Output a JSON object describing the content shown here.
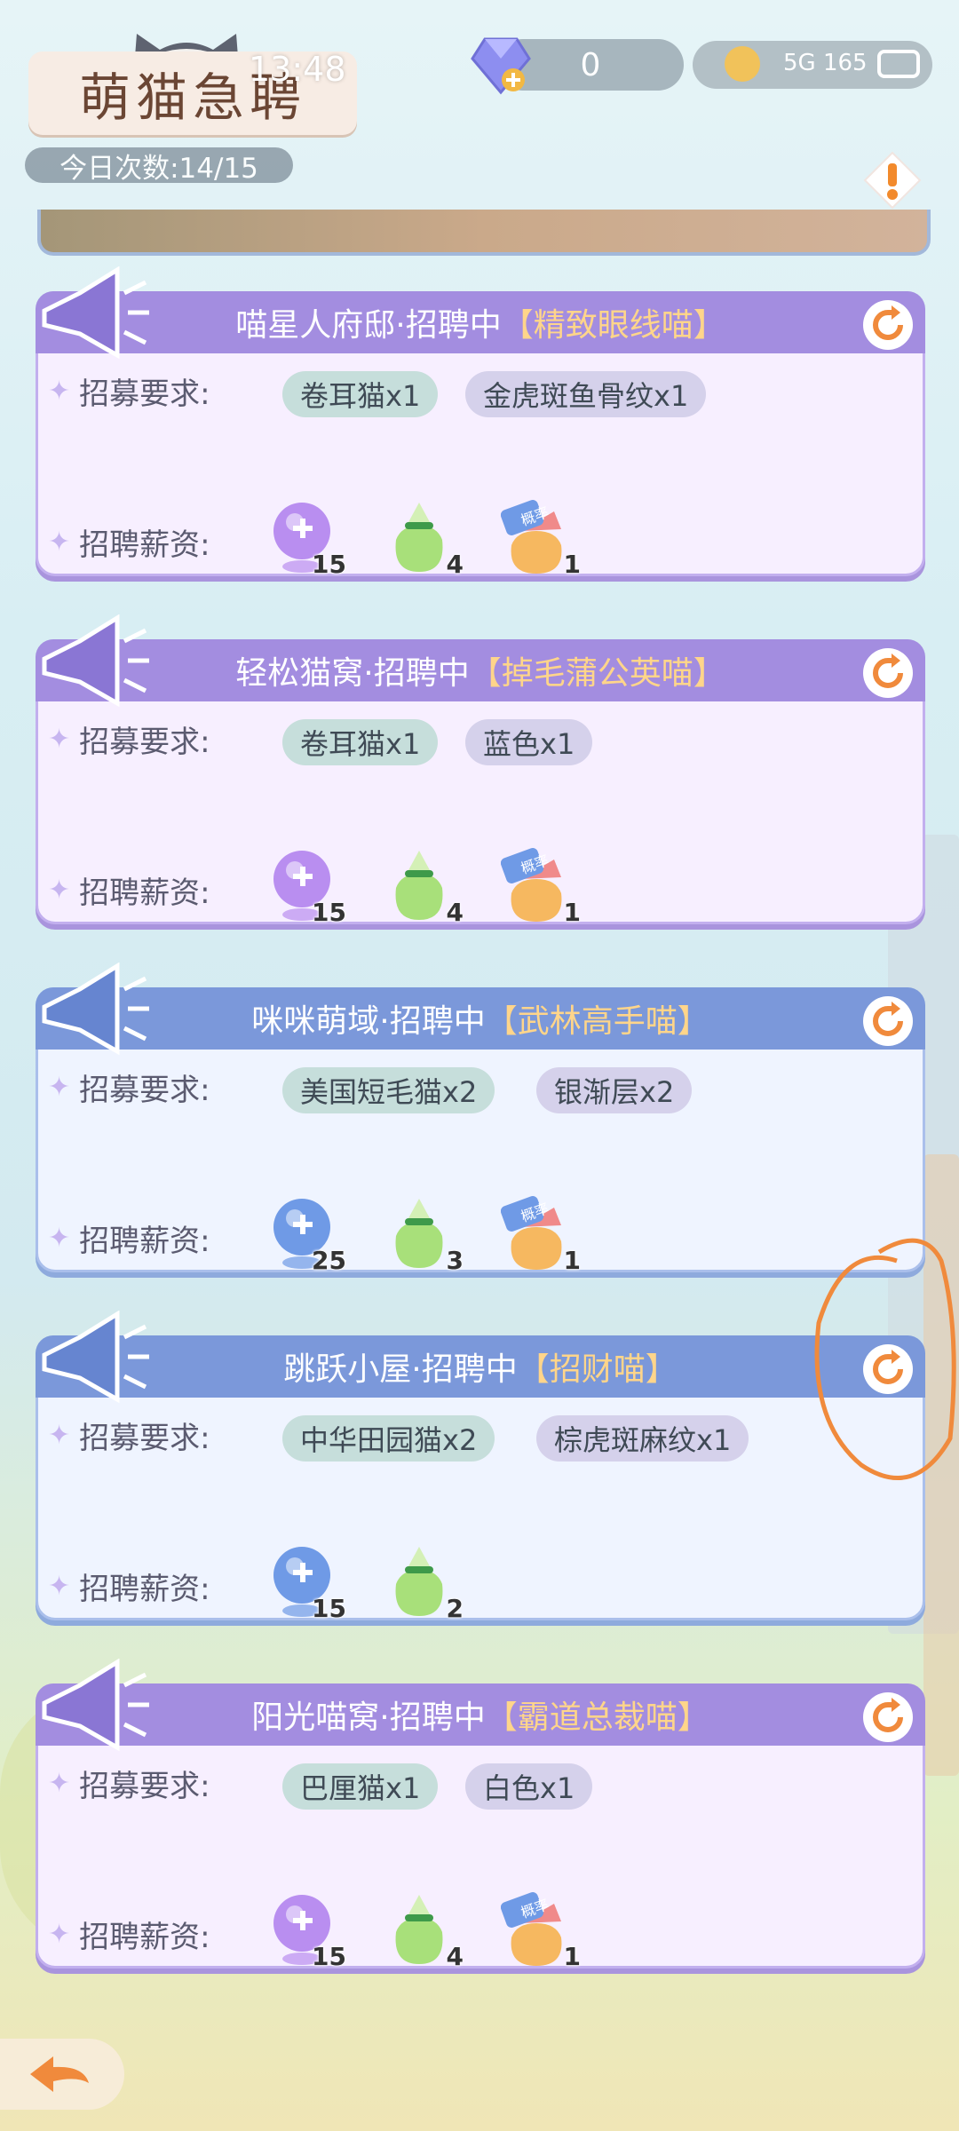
{
  "header": {
    "title": "萌猫急聘",
    "clock": "13:48",
    "daily_count": "今日次数:14/15",
    "currency_value": "0",
    "status": "5G 165"
  },
  "labels": {
    "requirements": "招募要求:",
    "salary": "招聘薪资:",
    "hiring": "·招聘中"
  },
  "cards": [
    {
      "place": "喵星人府邸",
      "cat": "【精致眼线喵】",
      "theme": "purple",
      "requirements": [
        "卷耳猫x1",
        "金虎斑鱼骨纹x1"
      ],
      "rewards": [
        {
          "icon": "purple-puzzle-orb-icon",
          "count": "15"
        },
        {
          "icon": "green-gift-pouch-icon",
          "count": "4"
        },
        {
          "icon": "mystery-bag-icon",
          "count": "1",
          "badge": "概率"
        }
      ]
    },
    {
      "place": "轻松猫窝",
      "cat": "【掉毛蒲公英喵】",
      "theme": "purple",
      "requirements": [
        "卷耳猫x1",
        "蓝色x1"
      ],
      "rewards": [
        {
          "icon": "purple-puzzle-orb-icon",
          "count": "15"
        },
        {
          "icon": "green-gift-pouch-icon",
          "count": "4"
        },
        {
          "icon": "mystery-bag-icon",
          "count": "1",
          "badge": "概率"
        }
      ]
    },
    {
      "place": "咪咪萌域",
      "cat": "【武林高手喵】",
      "theme": "blue",
      "requirements": [
        "美国短毛猫x2",
        "银渐层x2"
      ],
      "rewards": [
        {
          "icon": "blue-puzzle-orb-icon",
          "count": "25"
        },
        {
          "icon": "green-gift-pouch-icon",
          "count": "3"
        },
        {
          "icon": "mystery-bag-icon",
          "count": "1",
          "badge": "概率"
        }
      ]
    },
    {
      "place": "跳跃小屋",
      "cat": "【招财喵】",
      "theme": "blue",
      "requirements": [
        "中华田园猫x2",
        "棕虎斑麻纹x1"
      ],
      "rewards": [
        {
          "icon": "blue-puzzle-orb-icon",
          "count": "15"
        },
        {
          "icon": "green-gift-pouch-icon",
          "count": "2"
        }
      ]
    },
    {
      "place": "阳光喵窝",
      "cat": "【霸道总裁喵】",
      "theme": "purple",
      "requirements": [
        "巴厘猫x1",
        "白色x1"
      ],
      "rewards": [
        {
          "icon": "purple-puzzle-orb-icon",
          "count": "15"
        },
        {
          "icon": "green-gift-pouch-icon",
          "count": "4"
        },
        {
          "icon": "mystery-bag-icon",
          "count": "1",
          "badge": "概率"
        }
      ]
    }
  ],
  "colors": {
    "purple_header": "#a38de0",
    "blue_header": "#7b98da",
    "highlight_orange": "#ffd58a",
    "annotation": "#f08a3c"
  }
}
